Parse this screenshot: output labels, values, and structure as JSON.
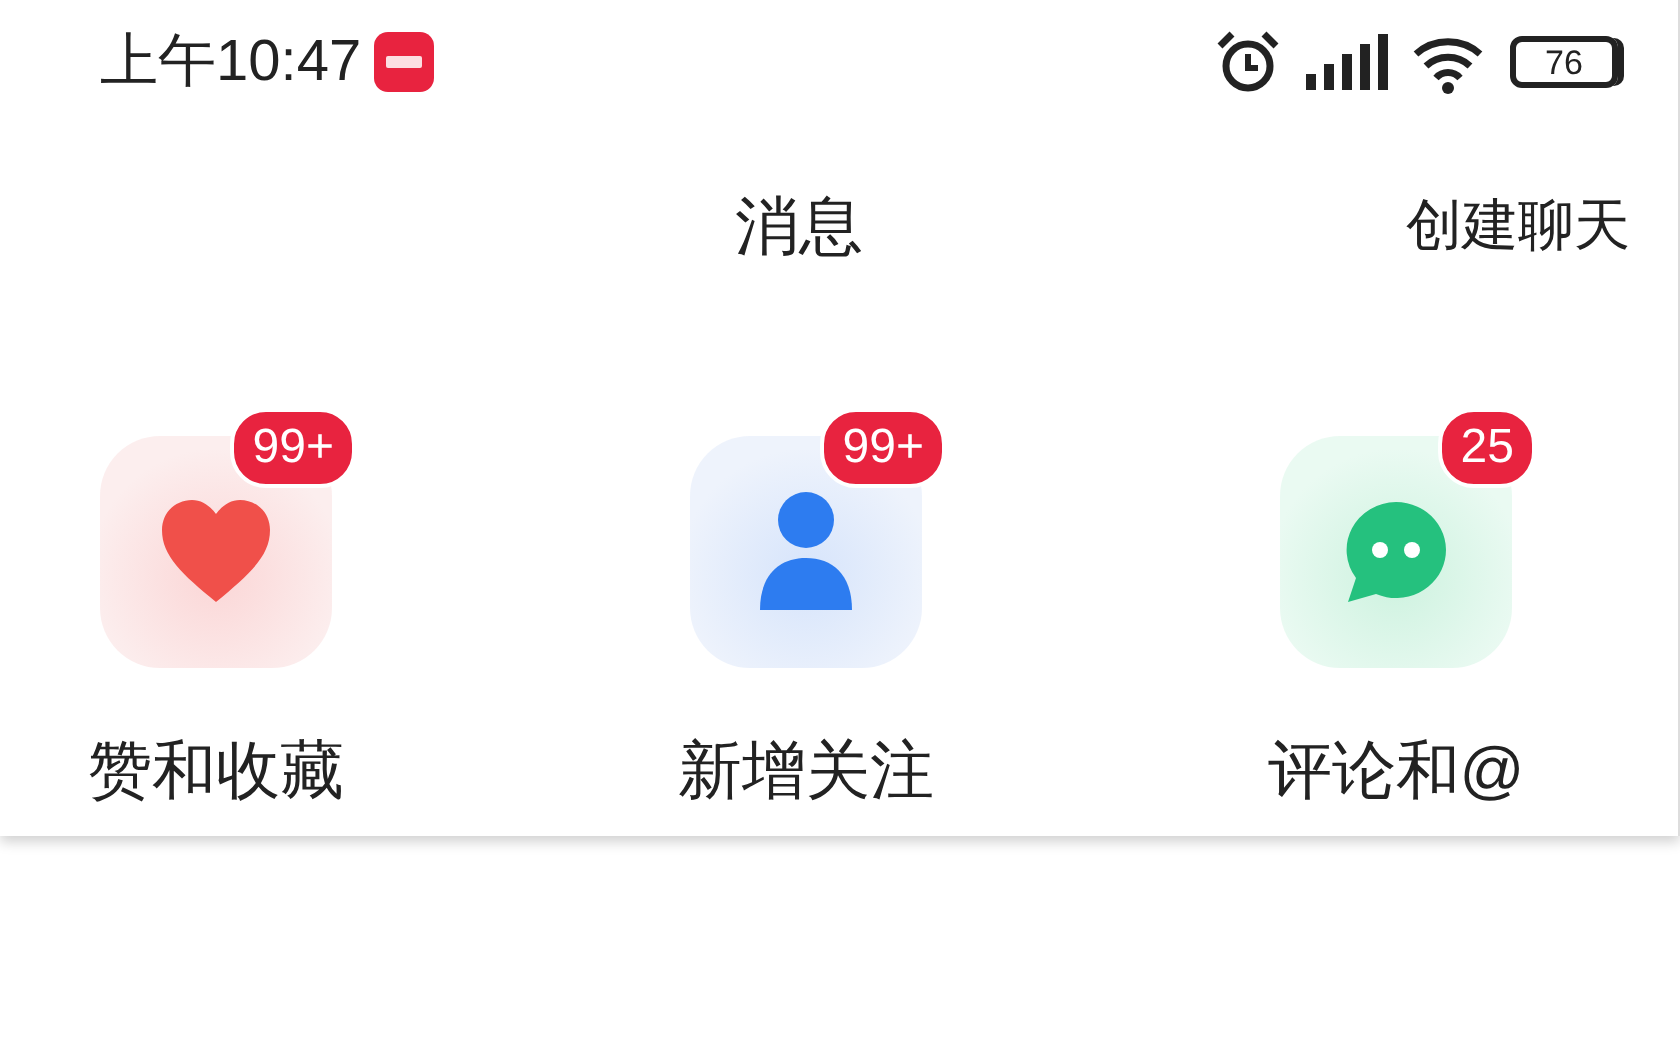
{
  "status_bar": {
    "time": "上午10:47",
    "battery": "76"
  },
  "header": {
    "title": "消息",
    "action": "创建聊天"
  },
  "shortcuts": [
    {
      "kind": "likes",
      "label": "赞和收藏",
      "badge": "99+"
    },
    {
      "kind": "follows",
      "label": "新增关注",
      "badge": "99+"
    },
    {
      "kind": "comments",
      "label": "评论和@",
      "badge": "25"
    }
  ]
}
